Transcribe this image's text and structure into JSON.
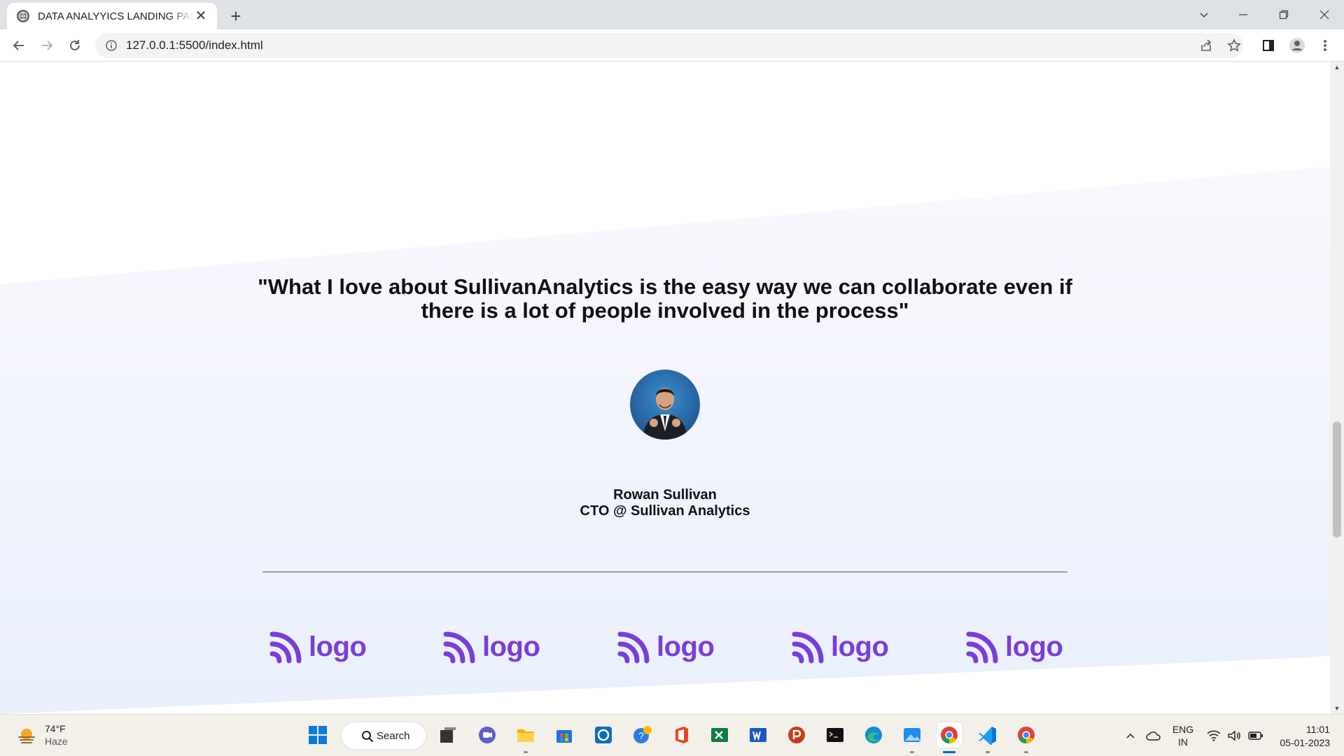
{
  "browser": {
    "tab_title": "DATA ANALYYICS LANDING PAGE",
    "url": "127.0.0.1:5500/index.html",
    "new_tab": "+",
    "close": "✕"
  },
  "page": {
    "quote": "\"What I love about SullivanAnalytics is the easy way we can collaborate even if there is a lot of people involved in the process\"",
    "author_name": "Rowan Sullivan",
    "author_role": "CTO @ Sullivan Analytics",
    "logos": [
      "logo",
      "logo",
      "logo",
      "logo",
      "logo"
    ],
    "accent_color": "#7a3ed8"
  },
  "taskbar": {
    "weather_temp": "74°F",
    "weather_condition": "Haze",
    "search_label": "Search",
    "language_top": "ENG",
    "language_bottom": "IN",
    "time": "11:01",
    "date": "05-01-2023",
    "apps": [
      "start",
      "search",
      "task-view",
      "teams",
      "file-explorer",
      "store",
      "app-blue",
      "help",
      "office",
      "excel",
      "word",
      "powerpoint",
      "terminal",
      "edge",
      "photos",
      "chrome",
      "vscode",
      "chrome-2"
    ]
  }
}
